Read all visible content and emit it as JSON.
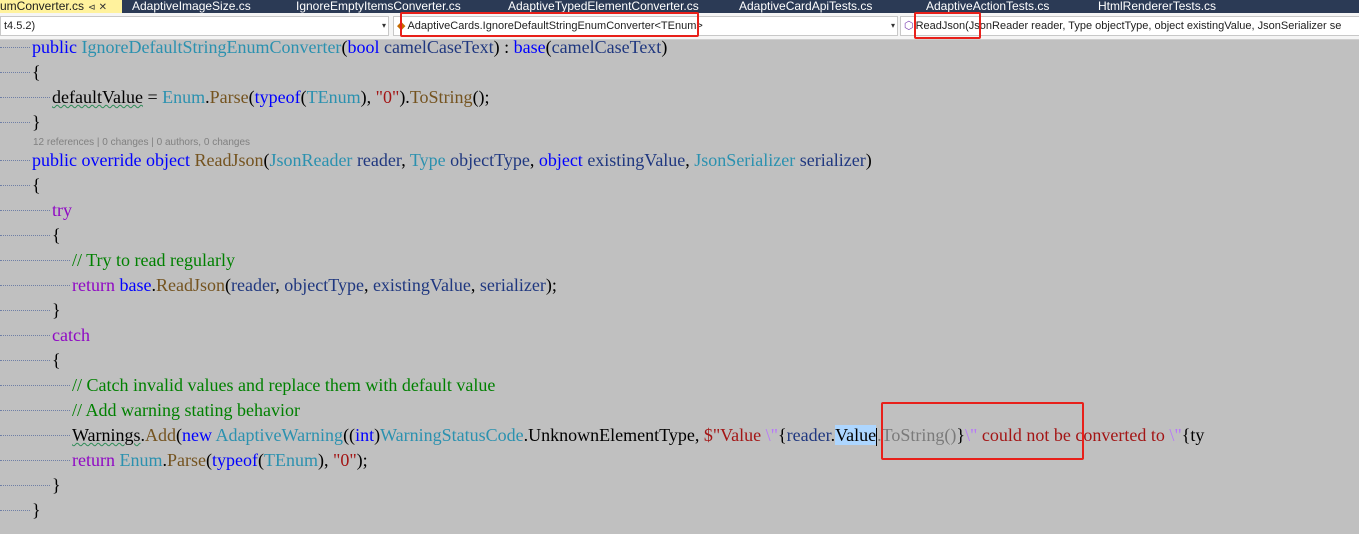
{
  "tabs": [
    {
      "label": "umConverter.cs",
      "pin": "⊲",
      "close": "✕"
    },
    {
      "label": "AdaptiveImageSize.cs"
    },
    {
      "label": "IgnoreEmptyItemsConverter.cs"
    },
    {
      "label": "AdaptiveTypedElementConverter.cs"
    },
    {
      "label": "AdaptiveCardApiTests.cs"
    },
    {
      "label": "AdaptiveActionTests.cs"
    },
    {
      "label": "HtmlRendererTests.cs"
    }
  ],
  "nav": {
    "project": "t4.5.2)",
    "class_label": "AdaptiveCards.IgnoreDefaultStringEnumConverter<TEnum>",
    "member_label": "ReadJson(JsonReader reader, Type objectType, object existingValue, JsonSerializer se",
    "dropdown_glyph": "▾"
  },
  "codelens": "12 references | 0 changes | 0 authors, 0 changes",
  "code": {
    "l1": {
      "a": "public ",
      "b": "IgnoreDefaultStringEnumConverter",
      "c": "(",
      "d": "bool ",
      "e": "camelCaseText",
      "f": ") : ",
      "g": "base",
      "h": "(",
      "i": "camelCaseText",
      "j": ")"
    },
    "l2": "{",
    "l3": {
      "a": "defaultValue",
      "b": " = ",
      "c": "Enum",
      "d": ".",
      "e": "Parse",
      "f": "(",
      "g": "typeof",
      "h": "(",
      "i": "TEnum",
      "j": "), ",
      "k": "\"0\"",
      "l": ").",
      "m": "ToString",
      "n": "();"
    },
    "l4": "}",
    "l5": {
      "a": "public ",
      "b": "override ",
      "c": "object ",
      "d": "ReadJson",
      "e": "(",
      "f": "JsonReader ",
      "g": "reader",
      "h": ", ",
      "i": "Type ",
      "j": "objectType",
      "k": ", ",
      "l": "object ",
      "m": "existingValue",
      "n": ", ",
      "o": "JsonSerializer ",
      "p": "serializer",
      "q": ")"
    },
    "l6": "{",
    "l7": "try",
    "l8": "{",
    "l9": "// Try to read regularly",
    "l10": {
      "a": "return ",
      "b": "base",
      "c": ".",
      "d": "ReadJson",
      "e": "(",
      "f": "reader",
      "g": ", ",
      "h": "objectType",
      "i": ", ",
      "j": "existingValue",
      "k": ", ",
      "l": "serializer",
      "m": ");"
    },
    "l11": "}",
    "l12": "catch",
    "l13": "{",
    "l14": "// Catch invalid values and replace them with default value",
    "l15": "// Add warning stating behavior",
    "l16": {
      "a": "Warnings",
      "b": ".",
      "c": "Add",
      "d": "(",
      "e": "new ",
      "f": "AdaptiveWarning",
      "g": "((",
      "h": "int",
      "i": ")",
      "j": "WarningStatusCode",
      "k": ".",
      "l": "UnknownElementType",
      "m": ", ",
      "n": "$\"Value ",
      "o": "\\\"",
      "p": "{",
      "q": "reader",
      "r": ".",
      "s": "Value",
      "t": ".",
      "u": "ToString",
      "v": "()",
      "w": "}",
      "x": "\\\"",
      "y": " could not be converted to ",
      "z": "\\\"",
      "z2": "{ty"
    },
    "l17": {
      "a": "return ",
      "b": "Enum",
      "c": ".",
      "d": "Parse",
      "e": "(",
      "f": "typeof",
      "g": "(",
      "h": "TEnum",
      "i": "), ",
      "j": "\"0\"",
      "k": ");"
    },
    "l18": "}",
    "l19": "}"
  },
  "colors": {
    "keyword": "#0000ff",
    "control": "#8f08c4",
    "type": "#2b91af",
    "method": "#74531f",
    "string": "#a31515",
    "comment": "#008000",
    "highlight_box": "#e8201a",
    "selection": "#add6ff"
  }
}
